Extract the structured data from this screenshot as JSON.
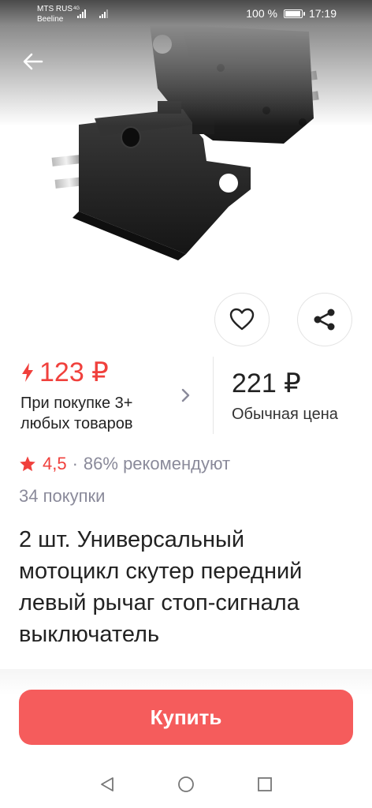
{
  "status_bar": {
    "carrier_1": "MTS RUS",
    "network_tag": "4G",
    "carrier_2": "Beeline",
    "battery_text": "100 %",
    "battery_level": 1.0,
    "time": "17:19"
  },
  "product": {
    "image_icon": "product-photo",
    "back_icon": "arrow-left-icon",
    "favorite_icon": "heart-icon",
    "share_icon": "share-icon"
  },
  "pricing": {
    "promo_price": "123 ₽",
    "promo_caption_line1": "При покупке 3+",
    "promo_caption_line2": "любых товаров",
    "regular_price": "221 ₽",
    "regular_caption": "Обычная цена",
    "accent_color": "#f0403c"
  },
  "rating": {
    "score": "4,5",
    "separator": "·",
    "recommend": "86% рекомендуют",
    "purchases": "34 покупки"
  },
  "title": {
    "line1": "2 шт. Универсальный",
    "line2": "мотоцикл скутер передний",
    "line3": "левый рычаг стоп-сигнала",
    "line4": "выключатель"
  },
  "buy": {
    "label": "Купить",
    "color": "#f55c5c"
  }
}
